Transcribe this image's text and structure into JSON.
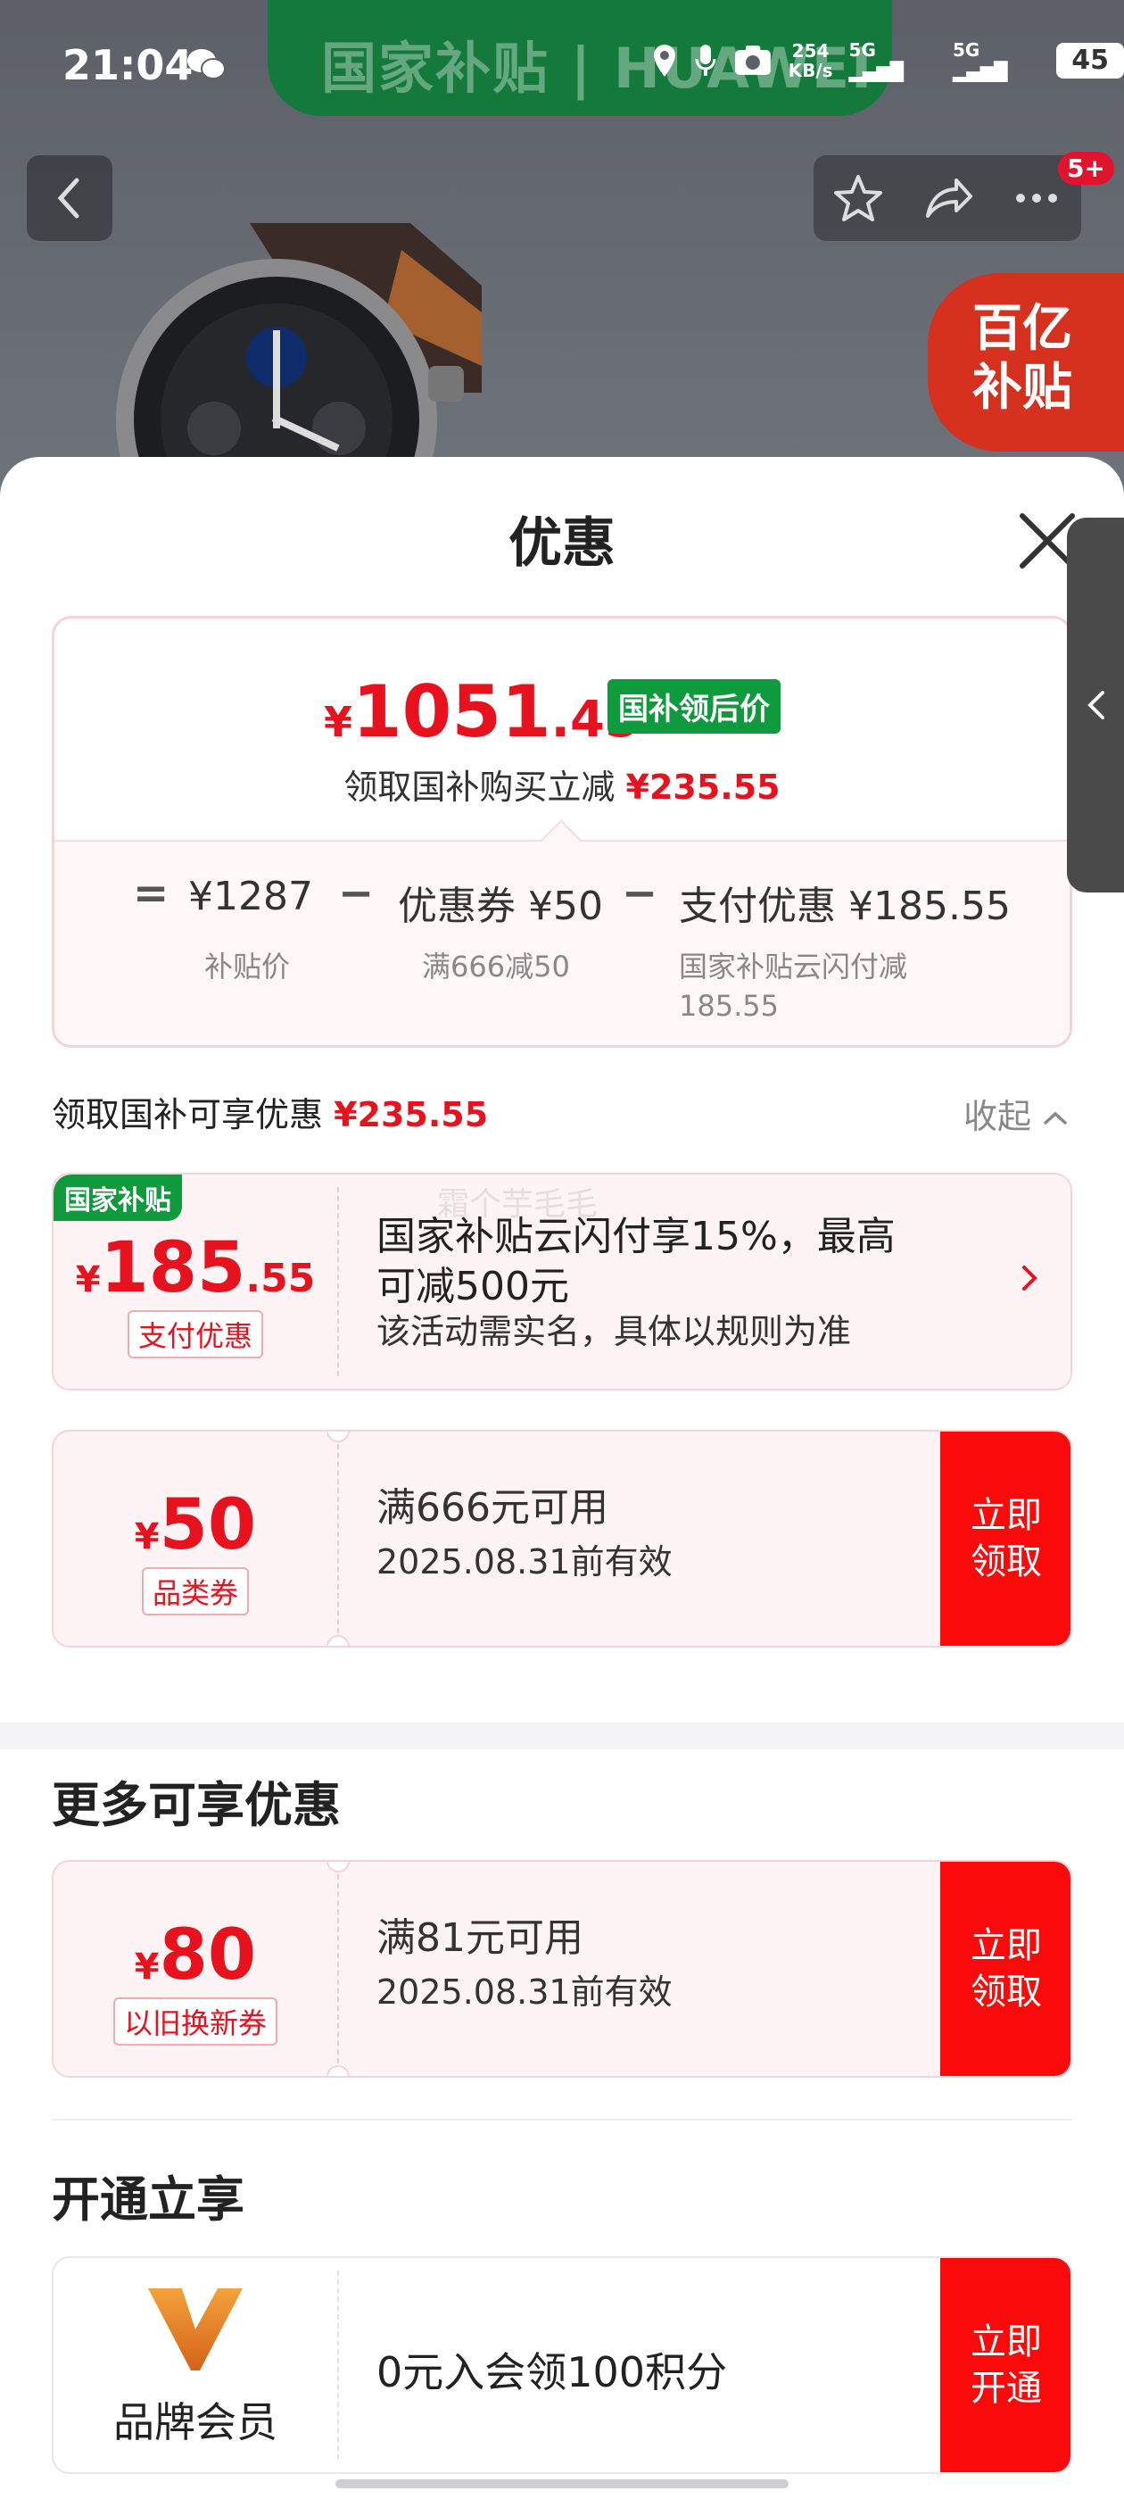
{
  "statusbar": {
    "time": "21:04",
    "promo_text": "国家补贴 | HUAWEI",
    "net_speed_value": "254",
    "net_speed_unit": "KB/s",
    "signal1": "5G",
    "signal2": "5G",
    "battery": "45"
  },
  "header": {
    "badge_count": "5+",
    "subsidy_badge": "百亿\n补贴"
  },
  "sheet": {
    "title": "优惠",
    "price_card": {
      "currency": "¥",
      "price_int": "1051",
      "price_dec": ".45",
      "tag": "国补领后价",
      "sub_text": "领取国补购买立减",
      "sub_amount": "¥235.55",
      "eq": "=",
      "minus": "−",
      "base_price": "¥1287",
      "base_label": "补贴价",
      "coupon_value": "优惠券 ¥50",
      "coupon_note": "满666减50",
      "pay_value": "支付优惠 ¥185.55",
      "pay_note": "国家补贴云闪付减 185.55"
    },
    "section": {
      "text": "领取国补可享优惠",
      "amount": "¥235.55",
      "collapse": "收起"
    },
    "coupon_pay": {
      "corner": "国家补贴",
      "yen": "¥",
      "big": "185",
      "small": ".55",
      "tag": "支付优惠",
      "title": "国家补贴云闪付享15%，最高可减500元",
      "sub": "该活动需实名，具体以规则为准",
      "watermark": "霜个芋毛毛"
    },
    "coupon_category": {
      "yen": "¥",
      "big": "50",
      "tag": "品类券",
      "title": "满666元可用",
      "sub": "2025.08.31前有效",
      "button": "立即\n领取"
    },
    "more": {
      "heading": "更多可享优惠",
      "coupon": {
        "yen": "¥",
        "big": "80",
        "tag": "以旧换新券",
        "title": "满81元可用",
        "sub": "2025.08.31前有效",
        "button": "立即\n领取"
      }
    },
    "open": {
      "heading": "开通立享",
      "member_label": "品牌会员",
      "member_text": "0元入会领100积分",
      "button": "立即\n开通"
    }
  },
  "colors": {
    "accent_red": "#e8121e",
    "button_red": "#fa0a0a",
    "green": "#0f9a3e"
  }
}
